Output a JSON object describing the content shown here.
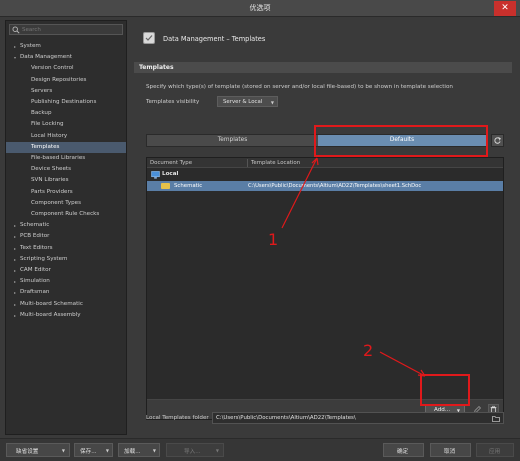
{
  "window": {
    "title": "优选项",
    "close_glyph": "✕"
  },
  "sidebar": {
    "search_placeholder": "Search",
    "items": [
      {
        "label": "System",
        "level": 0,
        "arrow": "▸"
      },
      {
        "label": "Data Management",
        "level": 0,
        "arrow": "▾"
      },
      {
        "label": "Version Control",
        "level": 1
      },
      {
        "label": "Design Repositories",
        "level": 1
      },
      {
        "label": "Servers",
        "level": 1
      },
      {
        "label": "Publishing Destinations",
        "level": 1
      },
      {
        "label": "Backup",
        "level": 1
      },
      {
        "label": "File Locking",
        "level": 1
      },
      {
        "label": "Local History",
        "level": 1
      },
      {
        "label": "Templates",
        "level": 1,
        "selected": true
      },
      {
        "label": "File-based Libraries",
        "level": 1
      },
      {
        "label": "Device Sheets",
        "level": 1
      },
      {
        "label": "SVN Libraries",
        "level": 1
      },
      {
        "label": "Parts Providers",
        "level": 1
      },
      {
        "label": "Component Types",
        "level": 1
      },
      {
        "label": "Component Rule Checks",
        "level": 1
      },
      {
        "label": "Schematic",
        "level": 0,
        "arrow": "▸"
      },
      {
        "label": "PCB Editor",
        "level": 0,
        "arrow": "▸"
      },
      {
        "label": "Text Editors",
        "level": 0,
        "arrow": "▸"
      },
      {
        "label": "Scripting System",
        "level": 0,
        "arrow": "▸"
      },
      {
        "label": "CAM Editor",
        "level": 0,
        "arrow": "▸"
      },
      {
        "label": "Simulation",
        "level": 0,
        "arrow": "▸"
      },
      {
        "label": "Draftsman",
        "level": 0,
        "arrow": "▸"
      },
      {
        "label": "Multi-board Schematic",
        "level": 0,
        "arrow": "▸"
      },
      {
        "label": "Multi-board Assembly",
        "level": 0,
        "arrow": "▸"
      }
    ]
  },
  "main": {
    "header_title": "Data Management – Templates",
    "section_title": "Templates",
    "description": "Specify which type(s) of template (stored on server and/or local file-based) to be shown in template selection",
    "visibility_label": "Templates visibility",
    "visibility_value": "Server & Local",
    "tabs": [
      {
        "label": "Templates",
        "active": false
      },
      {
        "label": "Defaults",
        "active": true
      }
    ],
    "grid": {
      "columns": [
        "Document Type",
        "Template Location"
      ],
      "group_label": "Local",
      "rows": [
        {
          "type": "Schematic",
          "location": "C:\\Users\\Public\\Documents\\Altium\\AD22\\Templates\\sheet1.SchDoc"
        }
      ]
    },
    "add_button": "Add...",
    "local_folder_label": "Local Templates folder",
    "local_folder_value": "C:\\Users\\Public\\Documents\\Altium\\AD22\\Templates\\"
  },
  "footer": {
    "default_settings": "缺省设置",
    "save": "保存...",
    "load": "加载...",
    "import": "导入...",
    "ok": "确定",
    "cancel": "取消",
    "apply": "应用"
  },
  "annotations": {
    "label_1": "1",
    "label_2": "2",
    "color": "#e0191b"
  },
  "icons": [
    "search-icon",
    "arrow-icon",
    "template-settings-icon",
    "refresh-icon",
    "monitor-icon",
    "folder-icon",
    "pencil-icon",
    "trash-icon",
    "folder-browse-icon",
    "close-icon"
  ]
}
